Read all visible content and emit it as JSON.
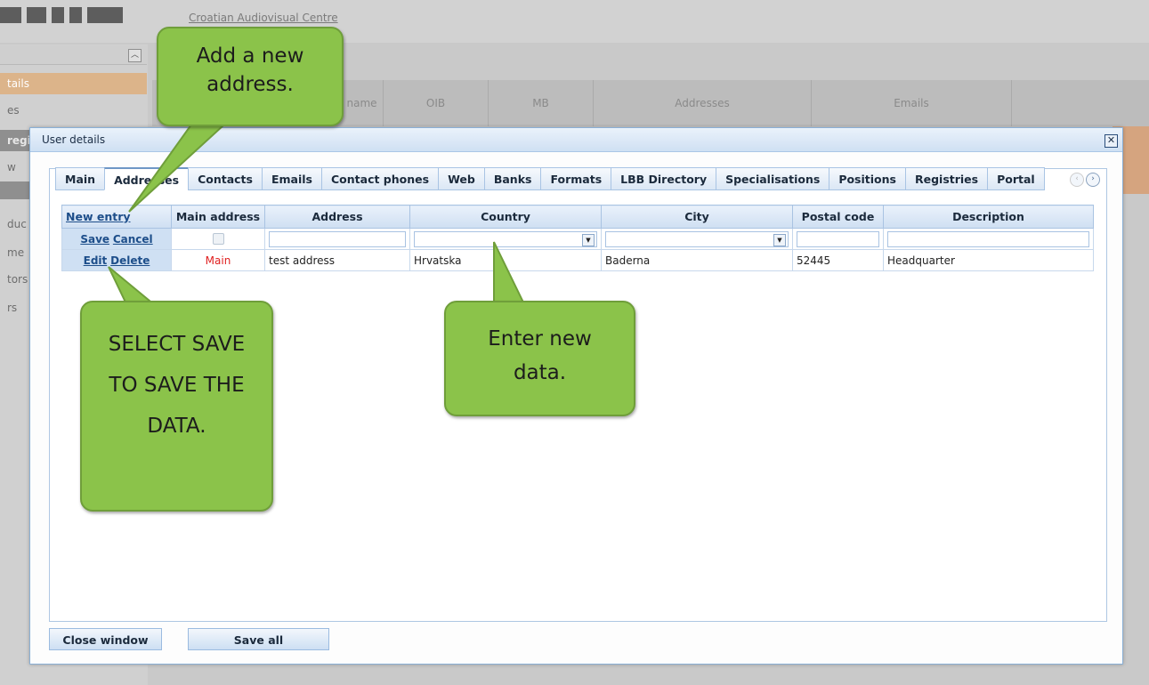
{
  "background": {
    "site_link": "Croatian Audiovisual Centre",
    "sidebar_items": [
      "tails",
      "es",
      "regi",
      "w",
      "",
      "duc",
      "me",
      "tors",
      "rs"
    ],
    "grid_headers": [
      "ll name",
      "OIB",
      "MB",
      "Addresses",
      "Emails"
    ]
  },
  "modal": {
    "title": "User details",
    "close_label": "✕"
  },
  "tabs": [
    "Main",
    "Addresses",
    "Contacts",
    "Emails",
    "Contact phones",
    "Web",
    "Banks",
    "Formats",
    "LBB Directory",
    "Specialisations",
    "Positions",
    "Registries",
    "Portal"
  ],
  "tab_nav": {
    "prev": "‹",
    "next": "›"
  },
  "grid": {
    "headers": {
      "command": "New entry",
      "main_address": "Main address",
      "address": "Address",
      "country": "Country",
      "city": "City",
      "postal_code": "Postal code",
      "description": "Description"
    },
    "edit_row": {
      "save": "Save",
      "cancel": "Cancel",
      "dropdown_icon": "▼"
    },
    "rows": [
      {
        "edit": "Edit",
        "delete": "Delete",
        "main_address": "Main",
        "address": "test address",
        "country": "Hrvatska",
        "city": "Baderna",
        "postal_code": "52445",
        "description": "Headquarter"
      }
    ]
  },
  "buttons": {
    "close_window": "Close window",
    "save_all": "Save all"
  },
  "callouts": {
    "add": "Add a new address.",
    "save": "SELECT SAVE TO SAVE THE DATA.",
    "enter": "Enter new data."
  },
  "colors": {
    "callout": "#8bc34a",
    "main_label": "#e02020",
    "header_blue": "#cfdff2"
  }
}
